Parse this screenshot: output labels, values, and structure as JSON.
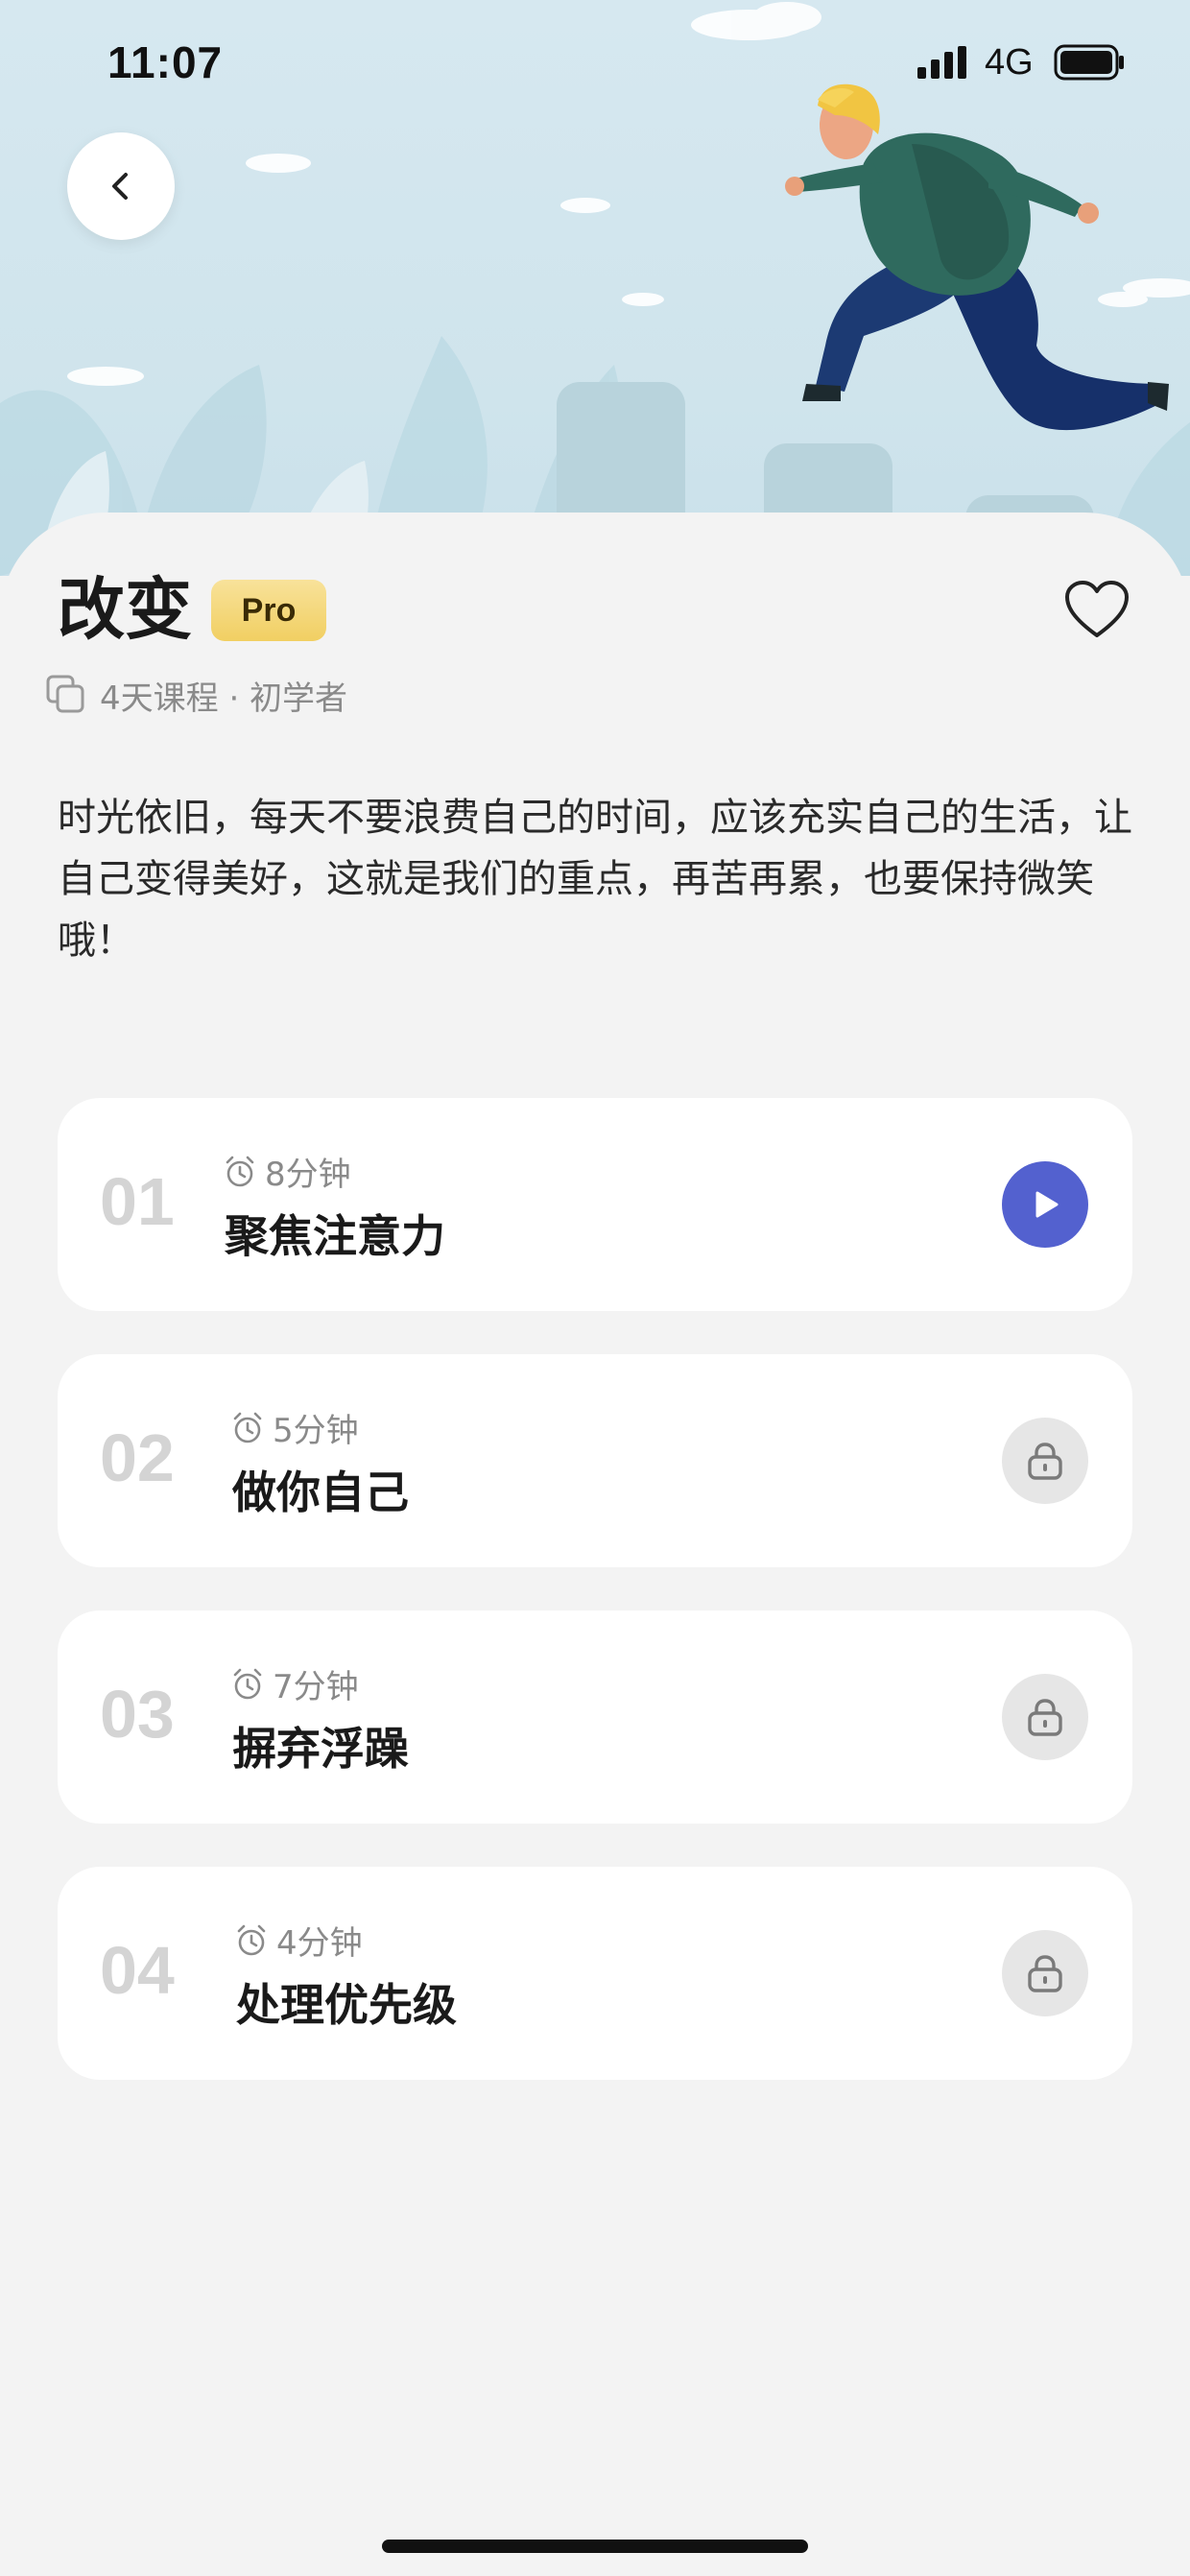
{
  "status_bar": {
    "time": "11:07",
    "network": "4G"
  },
  "course": {
    "title": "改变",
    "badge": "Pro",
    "meta": "4天课程 · 初学者",
    "description": "时光依旧，每天不要浪费自己的时间，应该充实自己的生活，让自己变得美好，这就是我们的重点，再苦再累，也要保持微笑哦！"
  },
  "lessons": [
    {
      "number": "01",
      "duration": "8分钟",
      "name": "聚焦注意力",
      "state": "play"
    },
    {
      "number": "02",
      "duration": "5分钟",
      "name": "做你自己",
      "state": "locked"
    },
    {
      "number": "03",
      "duration": "7分钟",
      "name": "摒弃浮躁",
      "state": "locked"
    },
    {
      "number": "04",
      "duration": "4分钟",
      "name": "处理优先级",
      "state": "locked"
    }
  ],
  "colors": {
    "accent": "#5361cf",
    "badge": "#f1cf62",
    "background": "#f3f3f3"
  }
}
